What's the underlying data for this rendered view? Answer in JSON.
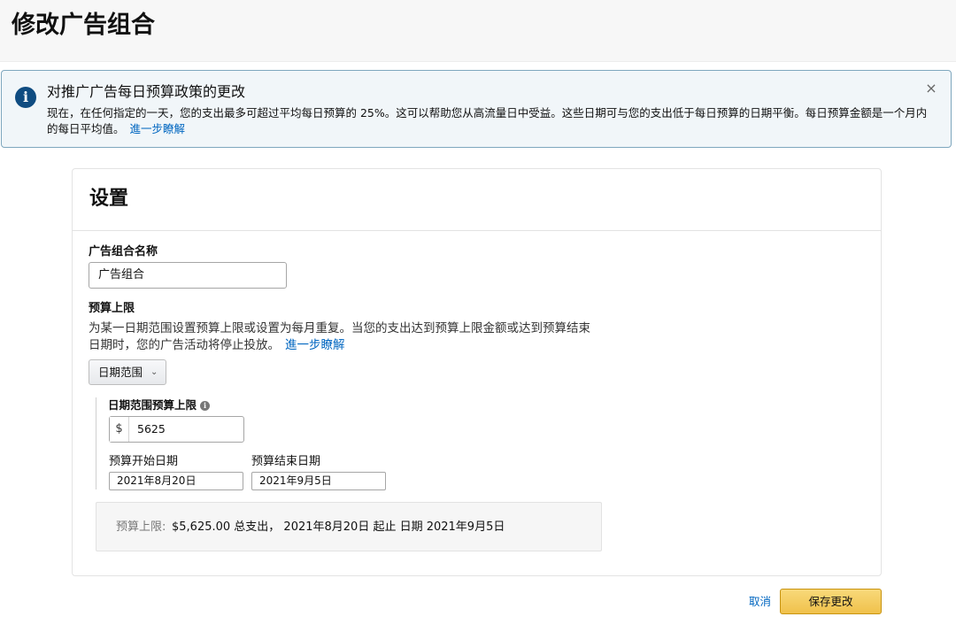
{
  "page": {
    "title": "修改广告组合"
  },
  "alert": {
    "icon": "info-icon",
    "title": "对推广广告每日预算政策的更改",
    "body": "现在，在任何指定的一天，您的支出最多可超过平均每日预算的 25%。这可以帮助您从高流量日中受益。这些日期可与您的支出低于每日预算的日期平衡。每日预算金额是一个月内的每日平均值。",
    "link": "進一步瞭解",
    "close": "×"
  },
  "settings": {
    "title": "设置",
    "name_label": "广告组合名称",
    "name_value": "广告组合",
    "budget_label": "预算上限",
    "budget_desc": "为某一日期范围设置预算上限或设置为每月重复。当您的支出达到预算上限金额或达到预算结束日期时，您的广告活动将停止投放。",
    "budget_link": "進一步瞭解",
    "dropdown_value": "日期范围",
    "cap_label": "日期范围预算上限",
    "currency_symbol": "$",
    "cap_value": "5625",
    "start_label": "预算开始日期",
    "start_value": "2021年8月20日",
    "end_label": "预算结束日期",
    "end_value": "2021年9月5日",
    "summary_label": "预算上限:",
    "summary_text": "$5,625.00 总支出， 2021年8月20日 起止 日期 2021年9月5日"
  },
  "footer": {
    "cancel": "取消",
    "save": "保存更改"
  },
  "colors": {
    "link": "#0066c0",
    "save_button": "#f0c14b",
    "alert_border": "#7fa7be",
    "info_icon": "#0f4c81"
  }
}
